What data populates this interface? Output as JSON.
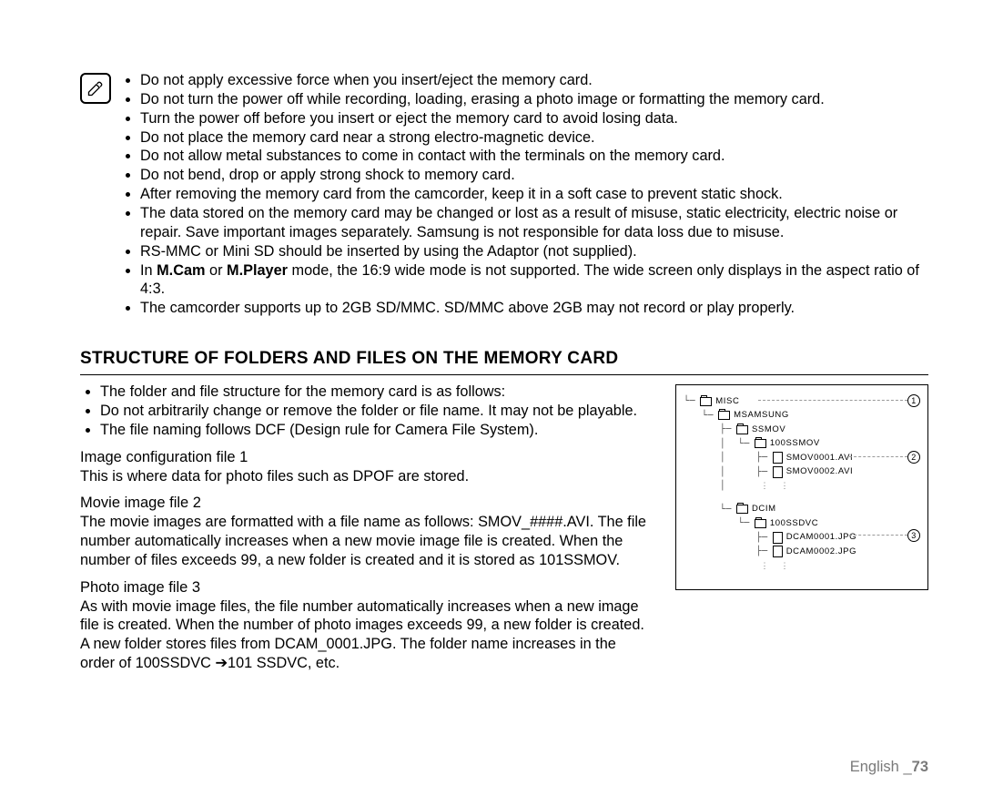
{
  "warnings": [
    "Do not apply excessive force when you insert/eject the memory card.",
    "Do not turn the power off while recording, loading, erasing a photo image or formatting the memory card.",
    "Turn the power off before you insert or eject the memory card to avoid losing data.",
    "Do not place the memory card near a strong electro-magnetic device.",
    "Do not allow metal substances to come in contact with the terminals on the memory card.",
    "Do not bend, drop or apply strong shock to memory card.",
    "After removing the memory card from the camcorder, keep it in a soft case to prevent static shock.",
    "The data stored on the memory card may be changed or lost as a result of misuse, static electricity, electric noise or repair. Save important images separately. Samsung is not responsible for data loss due to misuse.",
    "RS-MMC or Mini SD should be inserted by using the Adaptor (not supplied).",
    "In M.Cam or M.Player mode, the 16:9 wide mode is not supported. The wide screen only displays in the aspect ratio of 4:3.",
    "The camcorder supports up to 2GB SD/MMC. SD/MMC above 2GB may not record or play properly."
  ],
  "warnings_bold_terms": {
    "index": 9,
    "terms": [
      "M.Cam",
      "M.Player"
    ]
  },
  "section_title": "STRUCTURE OF FOLDERS AND FILES ON THE MEMORY CARD",
  "intro_bullets": [
    "The folder and file structure for the memory card is as follows:",
    "Do not arbitrarily change or remove the folder or file name. It may not be playable.",
    "The file naming follows DCF (Design rule for Camera File System)."
  ],
  "sections": [
    {
      "heading": "Image configuration file 1",
      "body": "This is where data for photo files such as DPOF are stored."
    },
    {
      "heading": "Movie image file 2",
      "body": "The movie images are formatted with a file name as follows: SMOV_####.AVI. The file number automatically increases when a new movie image file is created. When the number of files exceeds 99, a new folder is created and it is stored as 101SSMOV."
    },
    {
      "heading": "Photo image file 3",
      "body": "As with movie image files, the file number automatically increases when a new image file is created. When the number of photo images exceeds 99, a new folder is created.\nA new folder stores files from DCAM_0001.JPG. The folder name increases in the order of 100SSDVC ➔101 SSDVC, etc."
    }
  ],
  "tree": {
    "l1": "MISC",
    "l2": "MSAMSUNG",
    "l3": "SSMOV",
    "l4": "100SSMOV",
    "l5": "SMOV0001.AVI",
    "l6": "SMOV0002.AVI",
    "l7": "DCIM",
    "l8": "100SSDVC",
    "l9": "DCAM0001.JPG",
    "l10": "DCAM0002.JPG"
  },
  "callouts": {
    "c1": "1",
    "c2": "2",
    "c3": "3"
  },
  "footer": {
    "lang": "English",
    "sep": "_",
    "page": "73"
  }
}
